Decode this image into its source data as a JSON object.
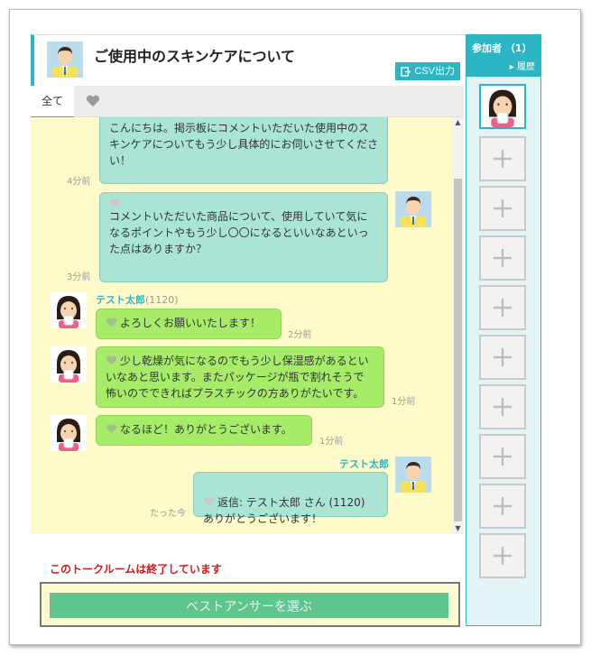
{
  "header": {
    "title": "ご使用中のスキンケアについて",
    "csv_label": "CSV出力"
  },
  "tabs": {
    "all": "全て"
  },
  "messages": [
    {
      "side": "right",
      "text": "こんにちは。掲示板にコメントいただいた使用中のスキンケアについてもう少し具体的にお伺いさせてください！",
      "time": "4分前"
    },
    {
      "side": "right",
      "text": "コメントいただいた商品について、使用していて気になるポイントやもう少し〇〇になるといいなあといった点はありますか？",
      "time": "3分前"
    },
    {
      "side": "left",
      "sender": "テスト太郎",
      "sender_count": "(1120)",
      "text": "よろしくお願いいたします！",
      "time": "2分前"
    },
    {
      "side": "left",
      "text": "少し乾燥が気になるのでもう少し保湿感があるといいなあと思います。またパッケージが瓶で割れそうで怖いのでできればプラスチックの方ありがたいです。",
      "time": "1分前"
    },
    {
      "side": "left",
      "text": "なるほど！ありがとうございます。",
      "time": "1分前"
    },
    {
      "side": "right",
      "sender": "テスト太郎",
      "text": "返信: テスト太郎 さん (1120)\nありがとうございます！",
      "time": "たった今"
    }
  ],
  "footer": {
    "ended_notice": "このトークルームは終了しています",
    "best_answer_label": "ベストアンサーを選ぶ"
  },
  "panel": {
    "title": "参加者 （1）",
    "history": "▸ 履歴",
    "participant_count": 1,
    "empty_slots": 9
  },
  "colors": {
    "accent": "#2eb5c4",
    "chat_bg": "#fffac9",
    "right_bubble": "#a9e4d4",
    "left_bubble": "#a6ec68",
    "alert": "#d11a1a",
    "best_btn": "#5ec58c"
  },
  "icons": [
    "csv-export-icon",
    "heart-icon",
    "plus-icon",
    "avatar-man",
    "avatar-woman"
  ]
}
